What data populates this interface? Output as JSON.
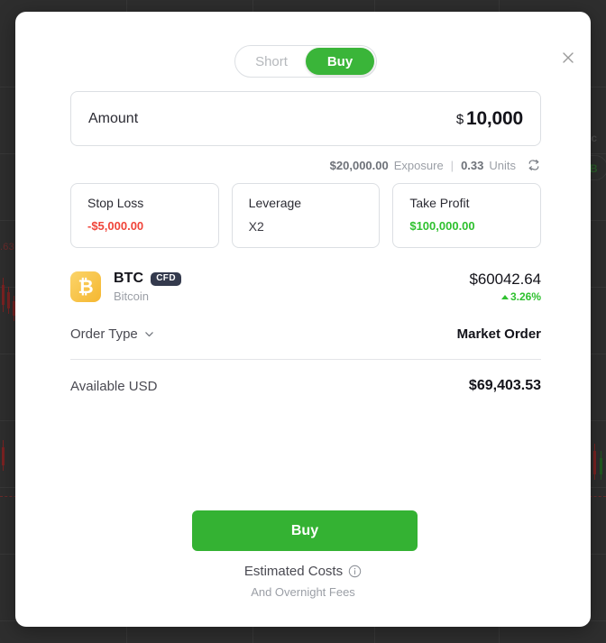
{
  "backdrop": {
    "price_label": ".63"
  },
  "modal": {
    "close_icon": "close-icon",
    "side_toggle": {
      "options": [
        {
          "label": "Short",
          "active": false
        },
        {
          "label": "Buy",
          "active": true
        }
      ]
    },
    "amount": {
      "label": "Amount",
      "currency": "$",
      "value": "10,000"
    },
    "exposure": {
      "amount": "$20,000.00",
      "amount_label": "Exposure",
      "separator": "|",
      "units": "0.33",
      "units_label": "Units",
      "swap_icon": "swap-icon"
    },
    "stat_cards": [
      {
        "title": "Stop Loss",
        "value": "-$5,000.00",
        "style": "neg"
      },
      {
        "title": "Leverage",
        "value": "X2",
        "style": "plain"
      },
      {
        "title": "Take Profit",
        "value": "$100,000.00",
        "style": "pos"
      }
    ],
    "asset": {
      "logo_icon": "bitcoin-icon",
      "logo_glyph": "₿",
      "symbol": "BTC",
      "badge": "CFD",
      "name": "Bitcoin",
      "price": "$60042.64",
      "change": "3.26%",
      "change_direction": "up"
    },
    "order_type": {
      "label": "Order Type",
      "chevron_icon": "chevron-down-icon",
      "value": "Market Order"
    },
    "available": {
      "label": "Available USD",
      "value": "$69,403.53"
    },
    "action_button": {
      "label": "Buy"
    },
    "footer": {
      "estimated_costs": "Estimated Costs",
      "info_icon": "info-icon",
      "overnight_fees": "And Overnight Fees"
    }
  },
  "colors": {
    "accent_green": "#34b233",
    "toggle_green": "#3ab539",
    "negative_red": "#f0453a",
    "positive_green": "#2fc12f",
    "badge_navy": "#343a4d",
    "bitcoin_gold": "#f5b731",
    "backdrop_dark": "#2e2e2e"
  }
}
